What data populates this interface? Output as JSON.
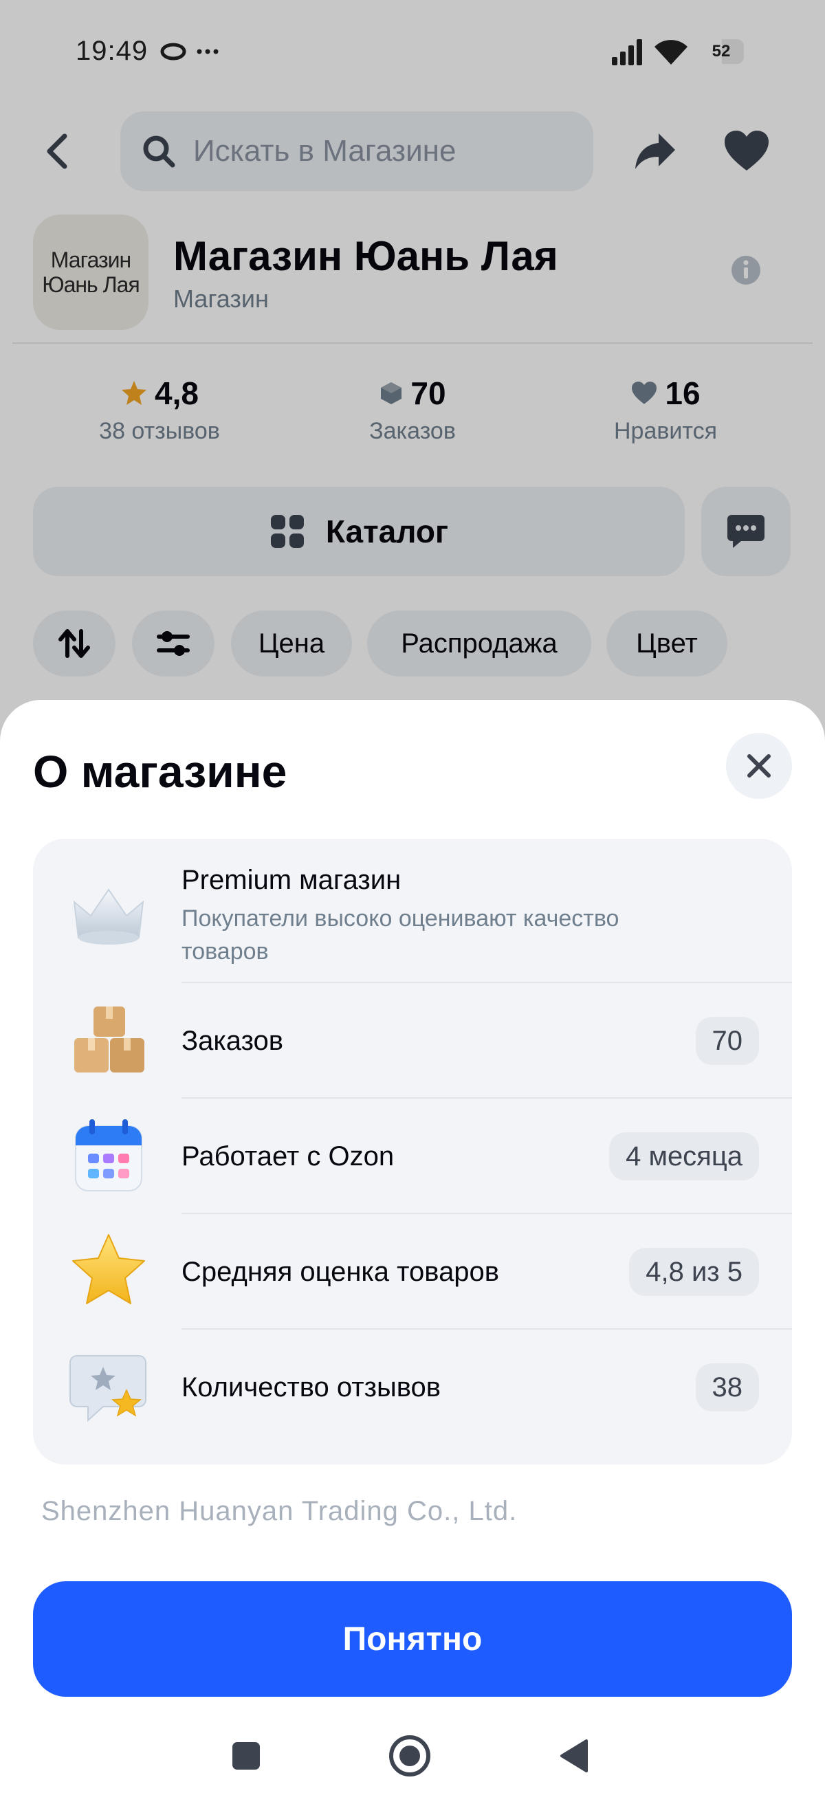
{
  "status_bar": {
    "time": "19:49",
    "battery_level": "52",
    "icons": [
      "link-icon",
      "more-dots-icon",
      "signal-icon",
      "wifi-icon",
      "battery-icon"
    ]
  },
  "topbar": {
    "search_placeholder": "Искать в Магазине",
    "icons": [
      "back-arrow-icon",
      "search-icon",
      "share-icon",
      "heart-icon"
    ]
  },
  "shop": {
    "logo_line1": "Магазин",
    "logo_line2": "Юань Лая",
    "name": "Магазин Юань Лая",
    "type": "Магазин"
  },
  "stats": [
    {
      "value": "4,8",
      "label": "38 отзывов",
      "icon": "star-icon"
    },
    {
      "value": "70",
      "label": "Заказов",
      "icon": "box-icon"
    },
    {
      "value": "16",
      "label": "Нравится",
      "icon": "heart-icon"
    }
  ],
  "catalog_label": "Каталог",
  "filters": {
    "price": "Цена",
    "sale": "Распродажа",
    "color": "Цвет"
  },
  "sheet": {
    "title": "О магазине",
    "rows": [
      {
        "title": "Premium магазин",
        "subtitle": "Покупатели высоко оценивают качество товаров",
        "icon": "crown-icon"
      },
      {
        "title": "Заказов",
        "badge": "70",
        "icon": "boxes-icon"
      },
      {
        "title": "Работает с Ozon",
        "badge": "4 месяца",
        "icon": "calendar-icon"
      },
      {
        "title": "Средняя оценка товаров",
        "badge": "4,8 из 5",
        "icon": "star-icon"
      },
      {
        "title": "Количество отзывов",
        "badge": "38",
        "icon": "review-icon"
      }
    ],
    "company": "Shenzhen Huanyan Trading Co., Ltd.",
    "ok_label": "Понятно"
  },
  "colors": {
    "accent": "#1f5cff",
    "star": "#f5a623",
    "text_secondary": "#707f8d"
  }
}
